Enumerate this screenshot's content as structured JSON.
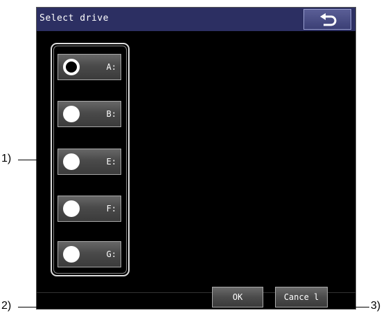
{
  "titlebar": {
    "title": "Select drive",
    "back_icon": "return-arrow-icon"
  },
  "drives": [
    {
      "label": "A:",
      "selected": true
    },
    {
      "label": "B:",
      "selected": false
    },
    {
      "label": "E:",
      "selected": false
    },
    {
      "label": "F:",
      "selected": false
    },
    {
      "label": "G:",
      "selected": false
    }
  ],
  "footer": {
    "ok_label": "OK",
    "cancel_label": "Cance l"
  },
  "callouts": {
    "c1": "1)",
    "c2": "2)",
    "c3": "3)"
  },
  "colors": {
    "titlebar": "#2c2f62",
    "screen_bg": "#000000"
  }
}
